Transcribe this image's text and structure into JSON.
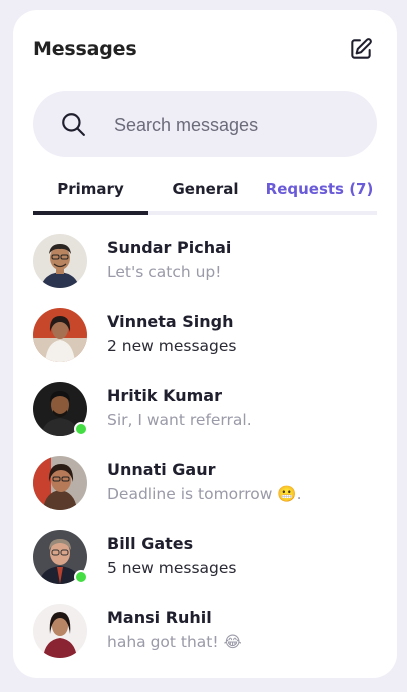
{
  "header": {
    "title": "Messages",
    "compose_icon": "edit-square-icon"
  },
  "search": {
    "placeholder": "Search messages",
    "value": "",
    "icon": "search-icon"
  },
  "tabs": [
    {
      "label": "Primary",
      "active": true
    },
    {
      "label": "General",
      "active": false
    },
    {
      "label": "Requests (7)",
      "active": false
    }
  ],
  "colors": {
    "accent": "#6a5bd8",
    "background": "#efeef7",
    "online": "#44dd44",
    "text_dark": "#1f1f2e"
  },
  "conversations": [
    {
      "name": "Sundar Pichai",
      "preview": "Let's catch up!",
      "unread": false,
      "online": false
    },
    {
      "name": "Vinneta Singh",
      "preview": "2 new messages",
      "unread": true,
      "online": false
    },
    {
      "name": "Hritik Kumar",
      "preview": "Sir, I want referral.",
      "unread": false,
      "online": true
    },
    {
      "name": "Unnati Gaur",
      "preview": "Deadline is tomorrow 😬.",
      "unread": false,
      "online": false
    },
    {
      "name": "Bill Gates",
      "preview": "5 new messages",
      "unread": true,
      "online": true
    },
    {
      "name": "Mansi Ruhil",
      "preview": "haha got that! 😂",
      "unread": false,
      "online": false
    }
  ]
}
